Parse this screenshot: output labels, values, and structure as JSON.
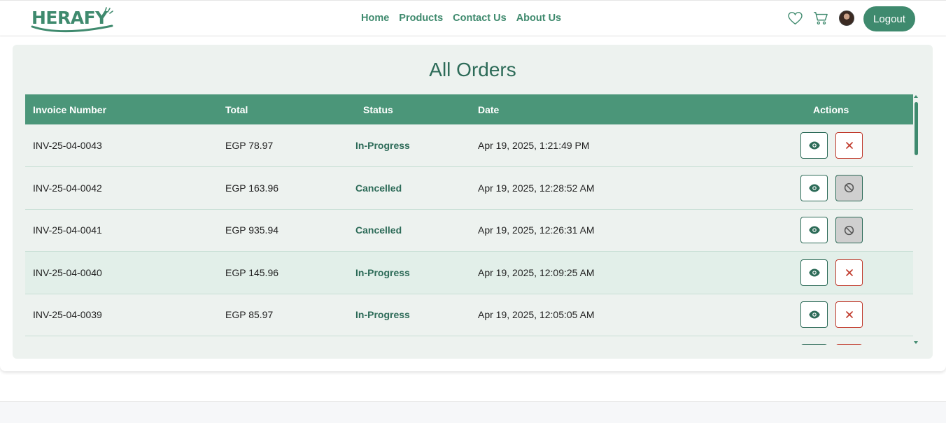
{
  "brand": {
    "logo_text": "HERAFY"
  },
  "nav": {
    "links": [
      "Home",
      "Products",
      "Contact Us",
      "About Us"
    ],
    "logout_label": "Logout"
  },
  "page": {
    "title": "All Orders"
  },
  "table": {
    "headers": {
      "invoice": "Invoice Number",
      "total": "Total",
      "status": "Status",
      "date": "Date",
      "actions": "Actions"
    },
    "rows": [
      {
        "invoice": "INV-25-04-0043",
        "total": "EGP 78.97",
        "status": "In-Progress",
        "date": "Apr 19, 2025, 1:21:49 PM",
        "cancel_state": "active"
      },
      {
        "invoice": "INV-25-04-0042",
        "total": "EGP 163.96",
        "status": "Cancelled",
        "date": "Apr 19, 2025, 12:28:52 AM",
        "cancel_state": "disabled"
      },
      {
        "invoice": "INV-25-04-0041",
        "total": "EGP 935.94",
        "status": "Cancelled",
        "date": "Apr 19, 2025, 12:26:31 AM",
        "cancel_state": "disabled"
      },
      {
        "invoice": "INV-25-04-0040",
        "total": "EGP 145.96",
        "status": "In-Progress",
        "date": "Apr 19, 2025, 12:09:25 AM",
        "cancel_state": "active"
      },
      {
        "invoice": "INV-25-04-0039",
        "total": "EGP 85.97",
        "status": "In-Progress",
        "date": "Apr 19, 2025, 12:05:05 AM",
        "cancel_state": "active"
      }
    ]
  },
  "colors": {
    "brand": "#3f8a6e",
    "header_bg": "#4b9679",
    "title": "#2d6b58",
    "danger": "#c0392b",
    "card_bg": "#edf2ef"
  }
}
